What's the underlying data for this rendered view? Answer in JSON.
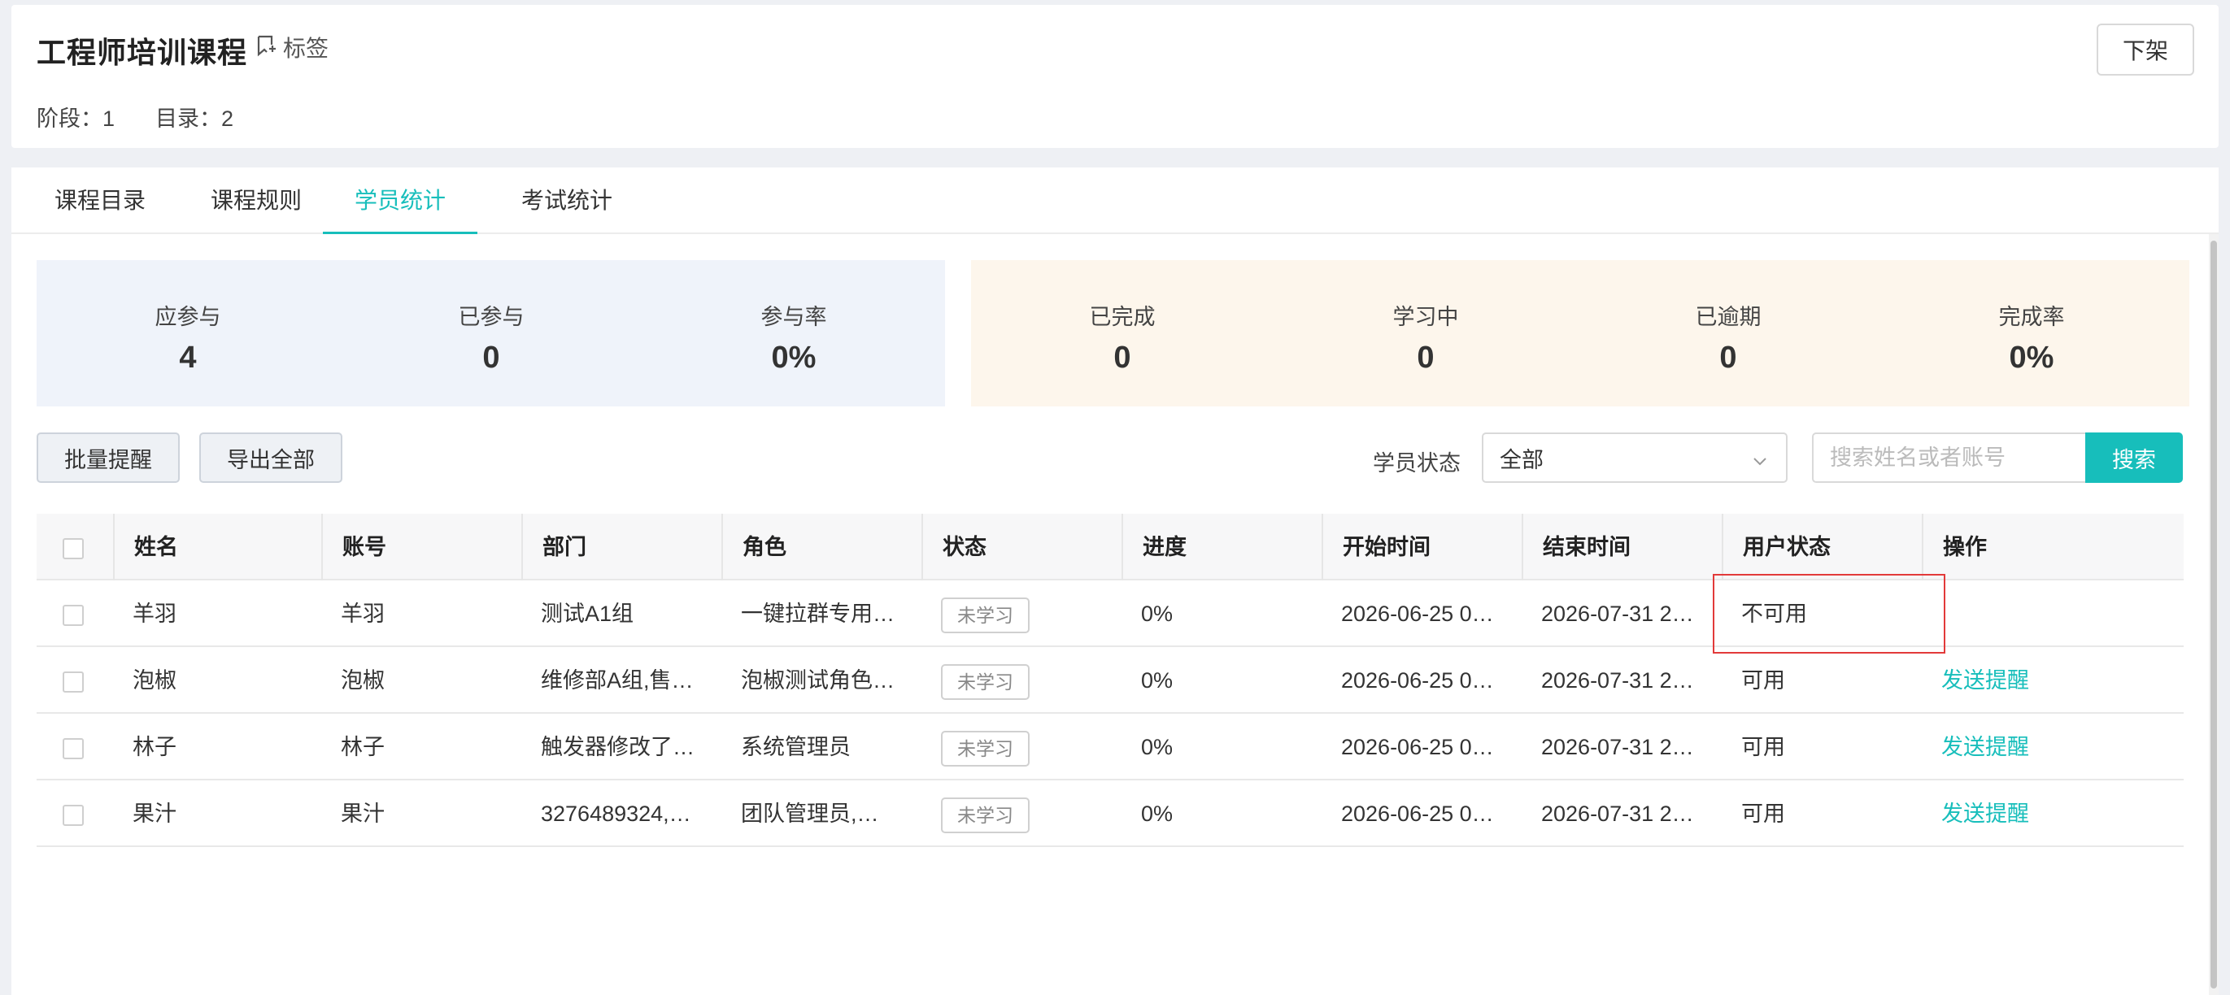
{
  "header": {
    "title": "工程师培训课程",
    "tag_label": "标签",
    "stage_text": "阶段：1",
    "catalog_text": "目录：2",
    "offshelf_label": "下架"
  },
  "tabs": [
    {
      "label": "课程目录",
      "active": false
    },
    {
      "label": "课程规则",
      "active": false
    },
    {
      "label": "学员统计",
      "active": true
    },
    {
      "label": "考试统计",
      "active": false
    }
  ],
  "stats_participation": [
    {
      "label": "应参与",
      "value": "4"
    },
    {
      "label": "已参与",
      "value": "0"
    },
    {
      "label": "参与率",
      "value": "0%"
    }
  ],
  "stats_progress": [
    {
      "label": "已完成",
      "value": "0"
    },
    {
      "label": "学习中",
      "value": "0"
    },
    {
      "label": "已逾期",
      "value": "0"
    },
    {
      "label": "完成率",
      "value": "0%"
    }
  ],
  "toolbar": {
    "batch_remind_label": "批量提醒",
    "export_all_label": "导出全部",
    "filter_label": "学员状态",
    "filter_value": "全部",
    "search_placeholder": "搜索姓名或者账号",
    "search_label": "搜索"
  },
  "table": {
    "columns": [
      "姓名",
      "账号",
      "部门",
      "角色",
      "状态",
      "进度",
      "开始时间",
      "结束时间",
      "用户状态",
      "操作"
    ],
    "rows": [
      {
        "name": "羊羽",
        "account": "羊羽",
        "dept": "测试A1组",
        "role": "一键拉群专用…",
        "status": "未学习",
        "progress": "0%",
        "start": "2026-06-25 0…",
        "end": "2026-07-31 2…",
        "user_status": "不可用",
        "action": ""
      },
      {
        "name": "泡椒",
        "account": "泡椒",
        "dept": "维修部A组,售…",
        "role": "泡椒测试角色…",
        "status": "未学习",
        "progress": "0%",
        "start": "2026-06-25 0…",
        "end": "2026-07-31 2…",
        "user_status": "可用",
        "action": "发送提醒"
      },
      {
        "name": "林子",
        "account": "林子",
        "dept": "触发器修改了…",
        "role": "系统管理员",
        "status": "未学习",
        "progress": "0%",
        "start": "2026-06-25 0…",
        "end": "2026-07-31 2…",
        "user_status": "可用",
        "action": "发送提醒"
      },
      {
        "name": "果汁",
        "account": "果汁",
        "dept": "3276489324,…",
        "role": "团队管理员,…",
        "status": "未学习",
        "progress": "0%",
        "start": "2026-06-25 0…",
        "end": "2026-07-31 2…",
        "user_status": "可用",
        "action": "发送提醒"
      }
    ]
  },
  "colors": {
    "accent": "#17bebb",
    "highlight": "#e23a3a",
    "stat_blue_bg": "#eff3fa",
    "stat_orange_bg": "#fdf6ec"
  }
}
